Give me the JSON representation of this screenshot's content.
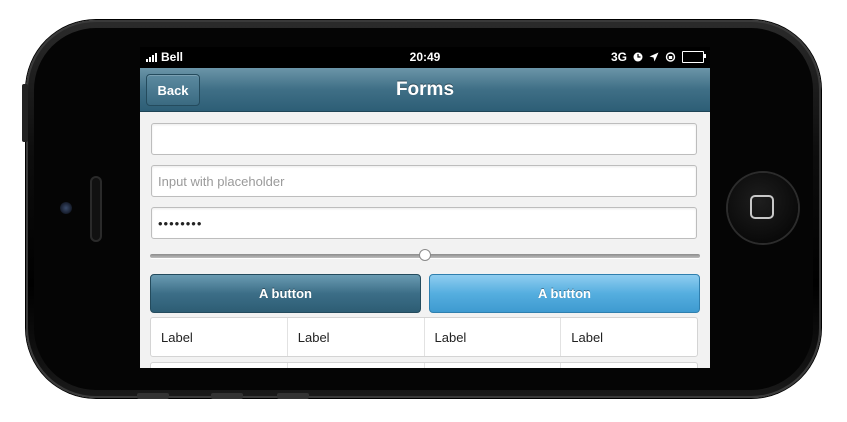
{
  "status_bar": {
    "carrier": "Bell",
    "time": "20:49",
    "network": "3G"
  },
  "nav_bar": {
    "back_label": "Back",
    "title": "Forms"
  },
  "form": {
    "text_input_value": "",
    "placeholder_input": "Input with placeholder",
    "password_mask": "••••••••",
    "slider_value_percent": 50
  },
  "buttons": {
    "left_label": "A button",
    "right_label": "A button"
  },
  "label_grid": {
    "row1": [
      "Label",
      "Label",
      "Label",
      "Label"
    ],
    "row2": [
      "",
      "",
      "",
      ""
    ]
  },
  "colors": {
    "nav_bar": "#3f6f86",
    "dark_button": "#3c6e87",
    "light_button": "#55aedf"
  }
}
